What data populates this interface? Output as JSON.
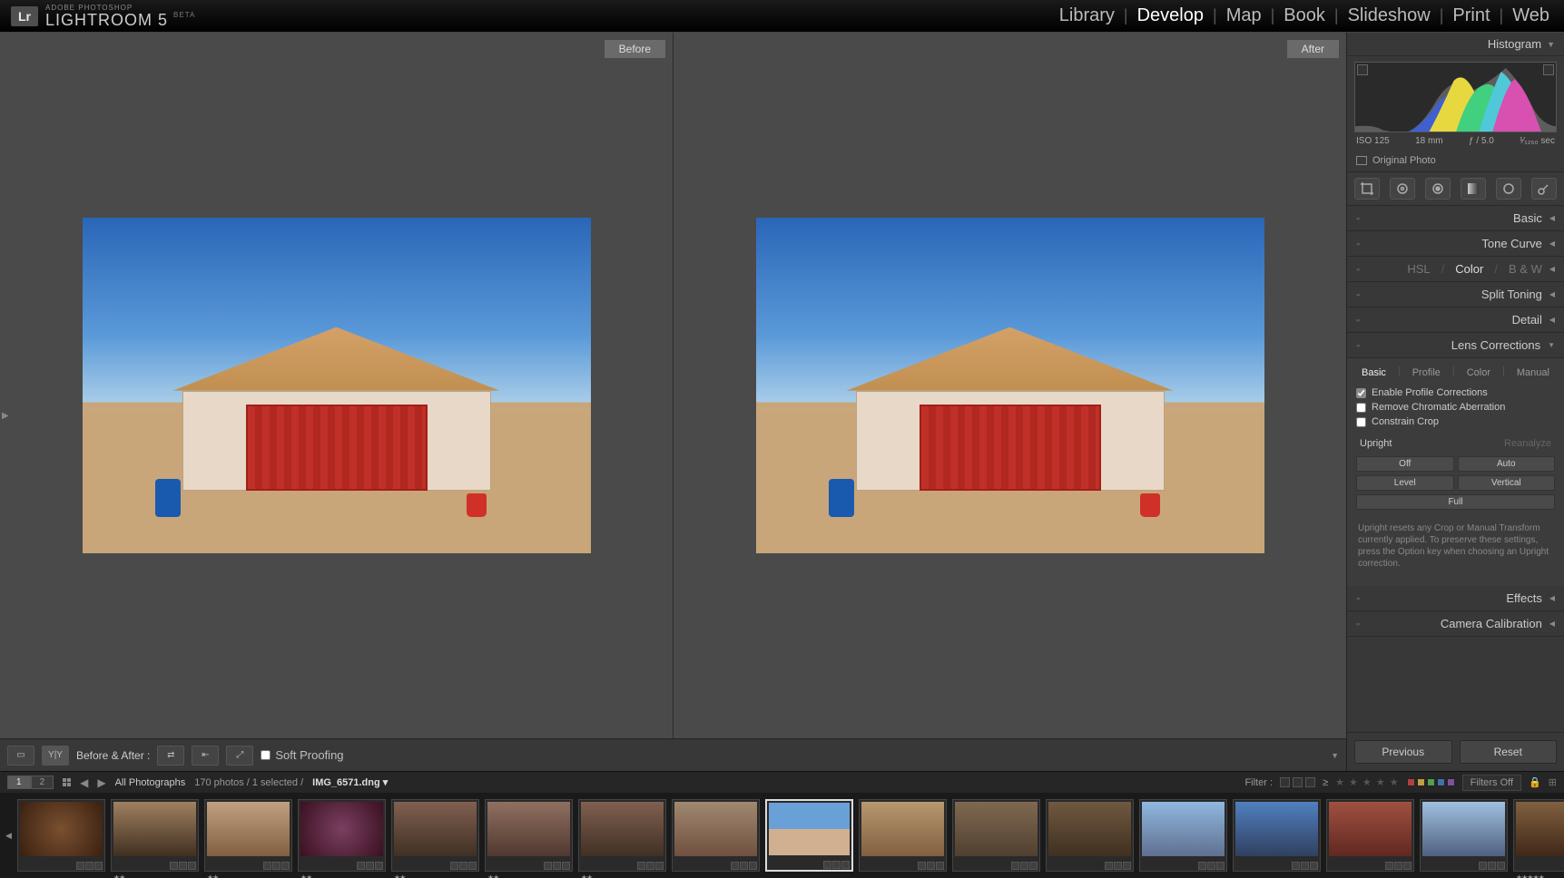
{
  "header": {
    "logo_badge": "Lr",
    "logo_top": "ADOBE PHOTOSHOP",
    "logo_main": "LIGHTROOM 5",
    "logo_beta": "BETA",
    "nav": [
      "Library",
      "Develop",
      "Map",
      "Book",
      "Slideshow",
      "Print",
      "Web"
    ],
    "nav_active": "Develop"
  },
  "viewer": {
    "before_label": "Before",
    "after_label": "After"
  },
  "viewer_toolbar": {
    "mode_label": "Before & After :",
    "soft_proofing": "Soft Proofing"
  },
  "right": {
    "histogram_title": "Histogram",
    "iso": "ISO 125",
    "focal": "18 mm",
    "aperture": "ƒ / 5.0",
    "shutter": "¹⁄₁₂₅₀ sec",
    "original_photo": "Original Photo",
    "sections": {
      "basic": "Basic",
      "tone_curve": "Tone Curve",
      "hsl": "HSL",
      "color": "Color",
      "bw": "B & W",
      "split_toning": "Split Toning",
      "detail": "Detail",
      "lens_corrections": "Lens Corrections",
      "effects": "Effects",
      "camera_calibration": "Camera Calibration"
    },
    "lens": {
      "tabs": [
        "Basic",
        "Profile",
        "Color",
        "Manual"
      ],
      "tab_active": "Basic",
      "enable_profile": "Enable Profile Corrections",
      "remove_ca": "Remove Chromatic Aberration",
      "constrain_crop": "Constrain Crop",
      "upright": "Upright",
      "reanalyze": "Reanalyze",
      "buttons": [
        "Off",
        "Auto",
        "Level",
        "Vertical",
        "Full"
      ],
      "hint": "Upright resets any Crop or Manual Transform currently applied. To preserve these settings, press the Option key when choosing an Upright correction."
    },
    "previous": "Previous",
    "reset": "Reset"
  },
  "filterbar": {
    "pages": [
      "1",
      "2"
    ],
    "source": "All Photographs",
    "count": "170 photos / 1 selected /",
    "filename": "IMG_6571.dng",
    "filter_label": "Filter :",
    "ge": "≥",
    "filters_off": "Filters Off",
    "color_labels": [
      "#b04040",
      "#c0a040",
      "#50a050",
      "#4070b0",
      "#8050a0"
    ]
  },
  "filmstrip": {
    "thumbs": [
      {
        "bg": "radial-gradient(circle,#7a5030,#3a2010)",
        "stars": ""
      },
      {
        "bg": "linear-gradient(#a08060,#403020)",
        "stars": "★★"
      },
      {
        "bg": "linear-gradient(#c0a080,#806040)",
        "stars": "★★"
      },
      {
        "bg": "radial-gradient(circle,#7a4060,#3a1020)",
        "stars": "★★"
      },
      {
        "bg": "linear-gradient(#806050,#403024)",
        "stars": "★★"
      },
      {
        "bg": "linear-gradient(#907060,#503830)",
        "stars": "★★"
      },
      {
        "bg": "linear-gradient(#806050,#403024)",
        "stars": "★★"
      },
      {
        "bg": "linear-gradient(#a08870,#705040)",
        "stars": ""
      },
      {
        "bg": "linear-gradient(#6aa0d8 50%,#d0b090 50%)",
        "stars": "",
        "selected": true
      },
      {
        "bg": "linear-gradient(#b89870,#806040)",
        "stars": ""
      },
      {
        "bg": "linear-gradient(#806850,#504030)",
        "stars": ""
      },
      {
        "bg": "linear-gradient(#705840,#403020)",
        "stars": ""
      },
      {
        "bg": "linear-gradient(#90b8e0,#607090)",
        "stars": ""
      },
      {
        "bg": "linear-gradient(#5080c0,#304060)",
        "stars": ""
      },
      {
        "bg": "linear-gradient(#a05040,#602820)",
        "stars": ""
      },
      {
        "bg": "linear-gradient(#a0c0e0,#506080)",
        "stars": ""
      },
      {
        "bg": "linear-gradient(#806040,#402818)",
        "stars": "★★★★★"
      }
    ]
  }
}
